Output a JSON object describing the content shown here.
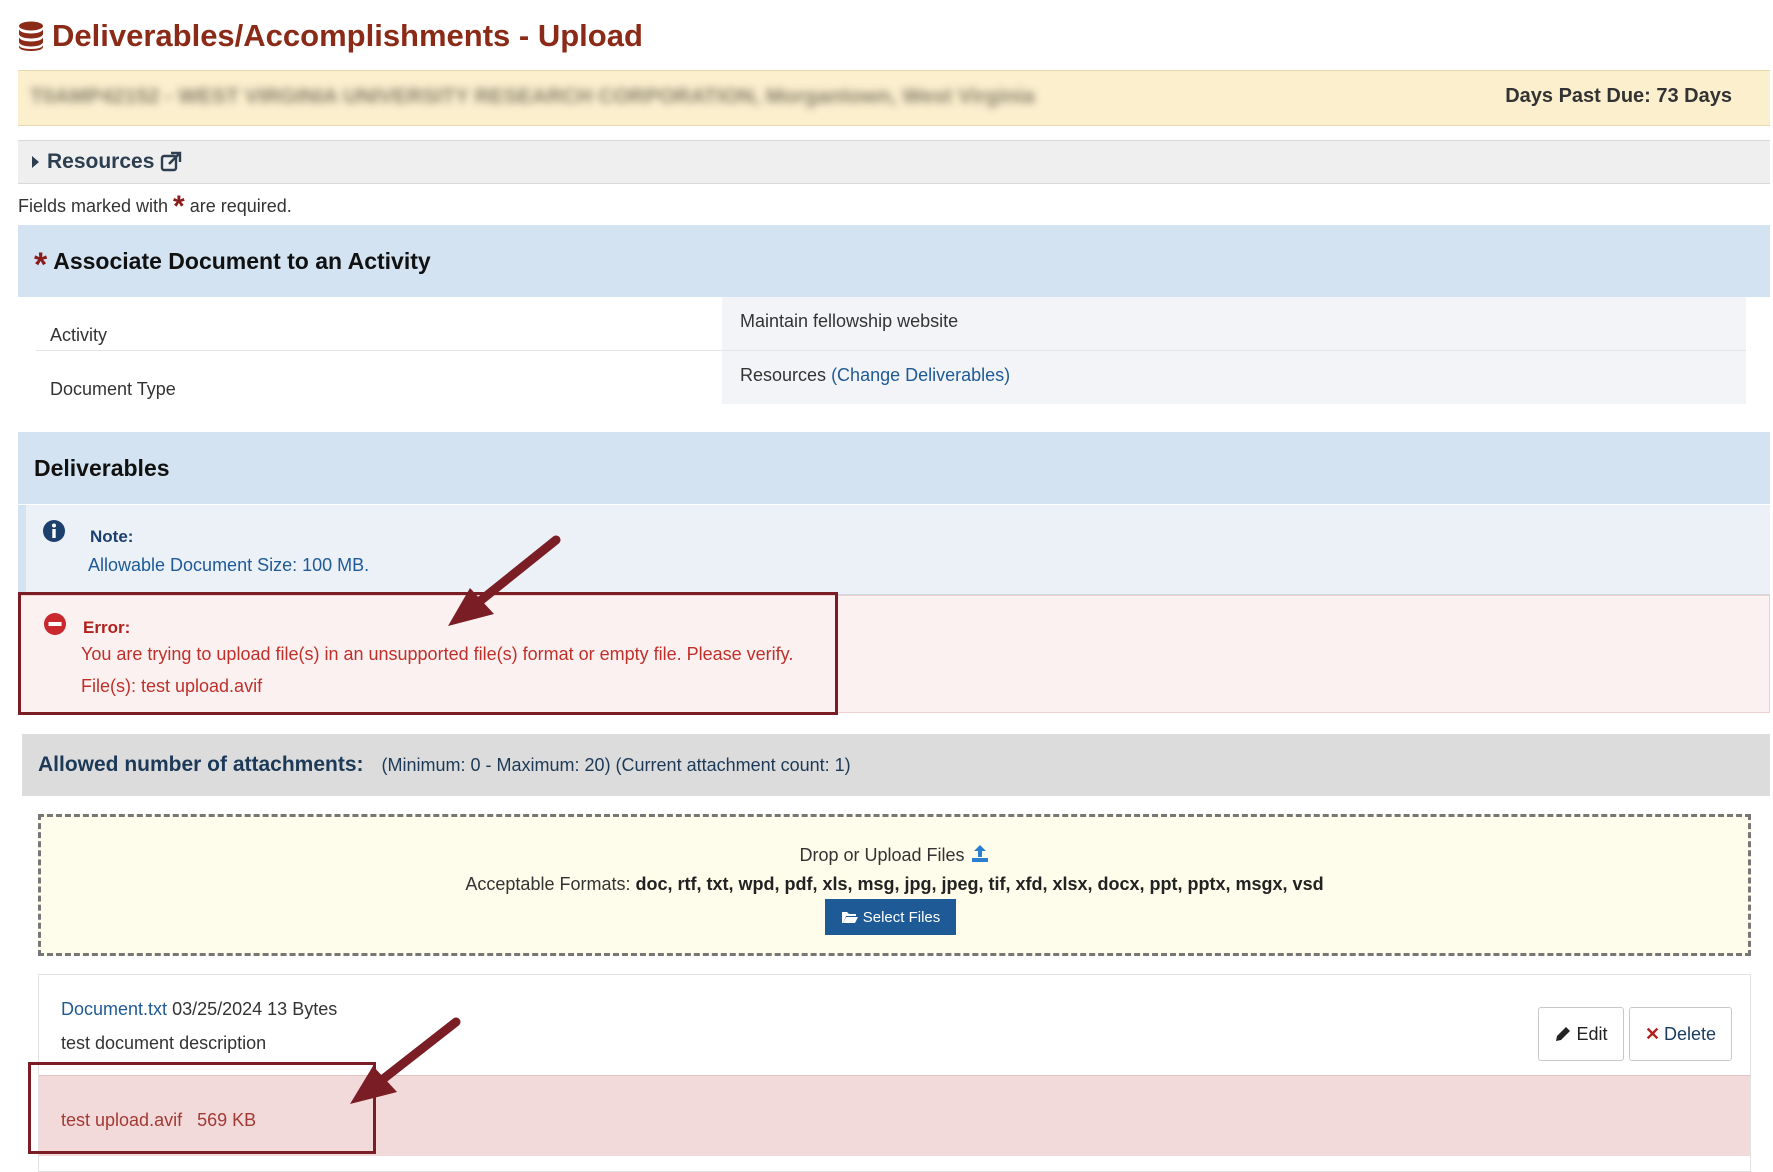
{
  "page": {
    "title": "Deliverables/Accomplishments - Upload",
    "title_icon": "database-icon"
  },
  "banner": {
    "obscured_text": "T0AMP42152 - WEST VIRGINIA UNIVERSITY RESEARCH CORPORATION, Morgantown, West Virginia",
    "days_past_due": "Days Past Due: 73 Days"
  },
  "resources": {
    "label": "Resources",
    "icon": "external-link-icon"
  },
  "required_note": {
    "before": "Fields marked with",
    "star": "*",
    "after": "are required."
  },
  "associate": {
    "star": "*",
    "title": "Associate Document to an Activity",
    "rows": [
      {
        "label": "Activity",
        "value": "Maintain fellowship website"
      },
      {
        "label": "Document Type",
        "value": "Resources",
        "link": "(Change Deliverables)"
      }
    ]
  },
  "deliverables": {
    "title": "Deliverables",
    "note": {
      "title": "Note:",
      "message": "Allowable Document Size: 100 MB.",
      "icon": "info-icon"
    },
    "error": {
      "title": "Error:",
      "message": "You are trying to upload file(s) in an unsupported file(s) format or empty file. Please verify.",
      "files": "File(s): test upload.avif",
      "icon": "error-minus-icon"
    },
    "attachments": {
      "title": "Allowed number of attachments:",
      "values": "(Minimum: 0 - Maximum: 20) (Current attachment count: 1)"
    },
    "dropzone": {
      "line1": "Drop or Upload Files",
      "upload_icon": "upload-icon",
      "formats_label": "Acceptable Formats:",
      "formats": "doc, rtf, txt, wpd, pdf, xls, msg, jpg, jpeg, tif, xfd, xlsx, docx, ppt, pptx, msgx, vsd",
      "select_button": "Select Files",
      "select_icon": "folder-open-icon"
    },
    "files": [
      {
        "name": "Document.txt",
        "date": "03/25/2024",
        "size": "13 Bytes",
        "description": "test document description",
        "edit_label": "Edit",
        "delete_label": "Delete"
      }
    ],
    "failed_file": {
      "name": "test upload.avif",
      "size": "569 KB"
    }
  },
  "colors": {
    "title": "#8b2a17",
    "banner": "#fbefce",
    "section_header": "#d3e3f1",
    "error_text": "#c0302a",
    "annotation": "#7a1d24",
    "button": "#1e5a96"
  }
}
